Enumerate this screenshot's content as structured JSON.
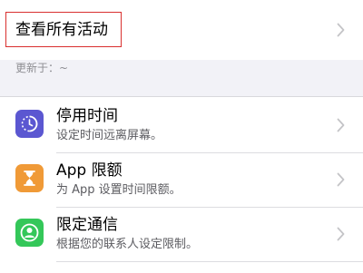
{
  "activity": {
    "see_all_label": "查看所有活动"
  },
  "updated": {
    "label": "更新于：",
    "value": "~"
  },
  "settings": [
    {
      "label": "停用时间",
      "subtitle": "设定时间远离屏幕。",
      "icon": "downtime-icon",
      "color": "#5b57d1"
    },
    {
      "label": "App 限额",
      "subtitle": "为 App 设置时间限额。",
      "icon": "hourglass-icon",
      "color": "#f09a37"
    },
    {
      "label": "限定通信",
      "subtitle": "根据您的联系人设定限制。",
      "icon": "contact-icon",
      "color": "#34c759"
    }
  ]
}
